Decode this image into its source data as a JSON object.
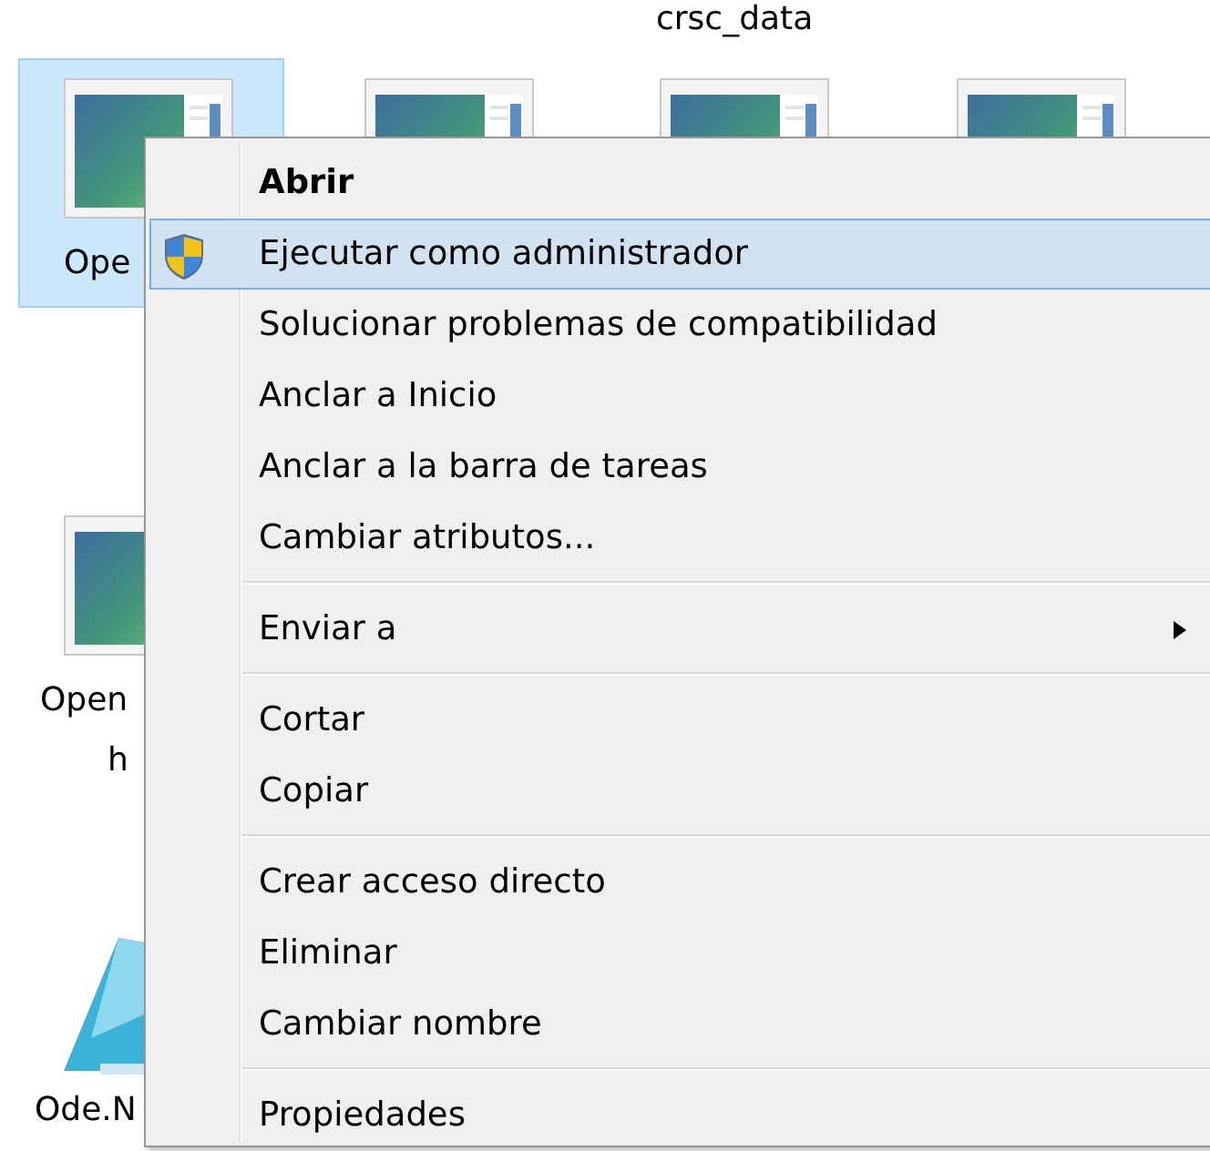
{
  "desktop": {
    "caption": "crsc_data",
    "icons": [
      {
        "kind": "window",
        "label": "Ope",
        "selected": true
      },
      {
        "kind": "window",
        "selected": false
      },
      {
        "kind": "window",
        "selected": false
      },
      {
        "kind": "window",
        "selected": false
      },
      {
        "kind": "window",
        "label": "Open",
        "label_line2": "h",
        "selected": false
      },
      {
        "kind": "app",
        "label": "Ode.N",
        "selected": false
      }
    ]
  },
  "context_menu": {
    "items": [
      {
        "kind": "item",
        "label": "Abrir",
        "bold": true,
        "selected": false
      },
      {
        "kind": "item",
        "label": "Ejecutar como administrador",
        "shield": true,
        "selected": true
      },
      {
        "kind": "item",
        "label": "Solucionar problemas de compatibilidad",
        "selected": false
      },
      {
        "kind": "item",
        "label": "Anclar a Inicio",
        "selected": false
      },
      {
        "kind": "item",
        "label": "Anclar a la barra de tareas",
        "selected": false
      },
      {
        "kind": "item",
        "label": "Cambiar atributos...",
        "selected": false
      },
      {
        "kind": "separator"
      },
      {
        "kind": "item",
        "label": "Enviar a",
        "submenu": true,
        "selected": false
      },
      {
        "kind": "separator"
      },
      {
        "kind": "item",
        "label": "Cortar",
        "selected": false
      },
      {
        "kind": "item",
        "label": "Copiar",
        "selected": false
      },
      {
        "kind": "separator"
      },
      {
        "kind": "item",
        "label": "Crear acceso directo",
        "selected": false
      },
      {
        "kind": "item",
        "label": "Eliminar",
        "selected": false
      },
      {
        "kind": "item",
        "label": "Cambiar nombre",
        "selected": false
      },
      {
        "kind": "separator"
      },
      {
        "kind": "item",
        "label": "Propiedades",
        "selected": false
      }
    ]
  }
}
